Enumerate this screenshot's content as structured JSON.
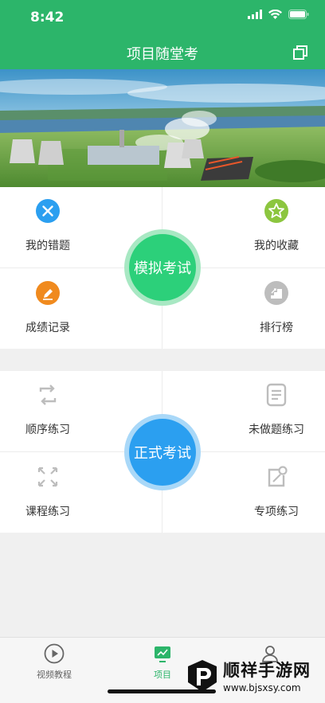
{
  "status": {
    "time": "8:42"
  },
  "header": {
    "title": "项目随堂考"
  },
  "mock_section": {
    "wrong": "我的错题",
    "favorites": "我的收藏",
    "scores": "成绩记录",
    "ranking": "排行榜",
    "button": "模拟考试"
  },
  "formal_section": {
    "sequential": "顺序练习",
    "undone": "未做题练习",
    "course": "课程练习",
    "special": "专项练习",
    "button": "正式考试"
  },
  "tabbar": {
    "video": "视频教程",
    "project": "项目"
  },
  "watermark": {
    "brand": "顺祥手游网",
    "url": "www.bjsxsy.com"
  },
  "colors": {
    "primary": "#2cb56a",
    "mock": "#2cd07a",
    "formal": "#2b9ff0"
  }
}
